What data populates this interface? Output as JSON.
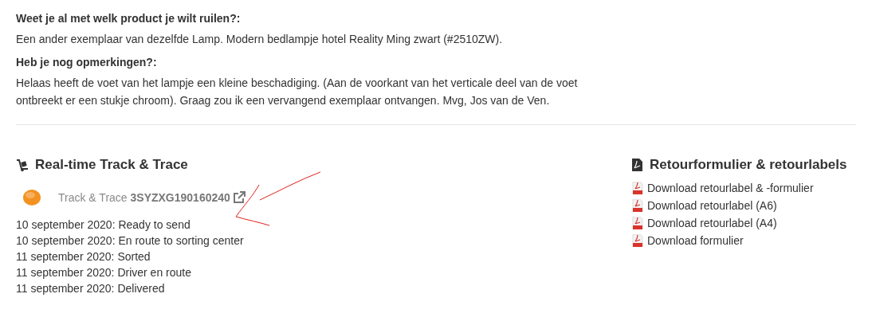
{
  "qa": [
    {
      "question": "Weet je al met welk product je wilt ruilen?:",
      "answer": "Een ander exemplaar van dezelfde Lamp. Modern bedlampje hotel Reality Ming zwart (#2510ZW)."
    },
    {
      "question": "Heb je nog opmerkingen?:",
      "answer": "Helaas heeft de voet van het lampje een kleine beschadiging. (Aan de voorkant van het verticale deel van de voet ontbreekt er een stukje chroom). Graag zou ik een vervangend exemplaar ontvangen. Mvg, Jos van de Ven."
    }
  ],
  "tracking": {
    "title": "Real-time Track & Trace",
    "label": "Track & Trace",
    "code": "3SYZXG190160240",
    "events": [
      "10 september 2020: Ready to send",
      "10 september 2020: En route to sorting center",
      "11 september 2020: Sorted",
      "11 september 2020: Driver en route",
      "11 september 2020: Delivered"
    ]
  },
  "downloads": {
    "title": "Retourformulier & retourlabels",
    "links": [
      "Download retourlabel & -formulier",
      "Download retourlabel (A6)",
      "Download retourlabel (A4)",
      "Download formulier"
    ]
  }
}
